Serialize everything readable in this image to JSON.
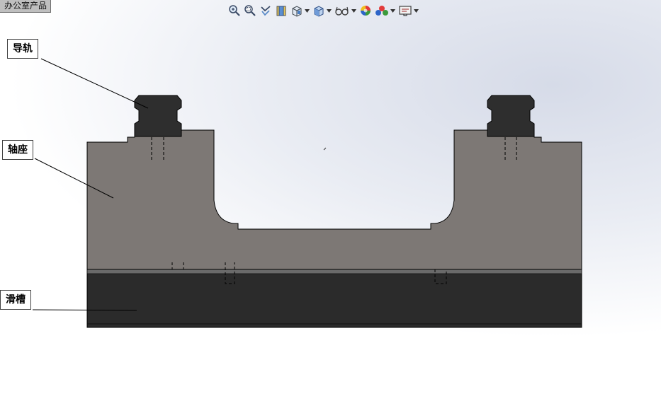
{
  "document": {
    "tab_label": "办公室产品"
  },
  "toolbar": {
    "buttons": [
      {
        "icon": "zoom-to-fit-icon"
      },
      {
        "icon": "zoom-to-area-icon"
      },
      {
        "icon": "previous-view-icon"
      },
      {
        "icon": "section-view-icon"
      },
      {
        "icon": "view-orientation-icon",
        "has_dropdown": true
      },
      {
        "icon": "display-style-icon",
        "has_dropdown": true
      },
      {
        "icon": "hide-show-items-icon",
        "has_dropdown": true
      },
      {
        "icon": "edit-appearance-icon"
      },
      {
        "icon": "apply-scene-icon",
        "has_dropdown": true
      },
      {
        "icon": "view-settings-icon",
        "has_dropdown": true
      }
    ],
    "dropdown_glyph": "▾"
  },
  "callouts": {
    "rail": "导轨",
    "bearing_seat": "轴座",
    "slide_groove": "滑槽"
  },
  "colors": {
    "bearing_seat": "#7d7875",
    "slide_groove": "#2b2b2b",
    "rail": "#2e2e2e"
  }
}
